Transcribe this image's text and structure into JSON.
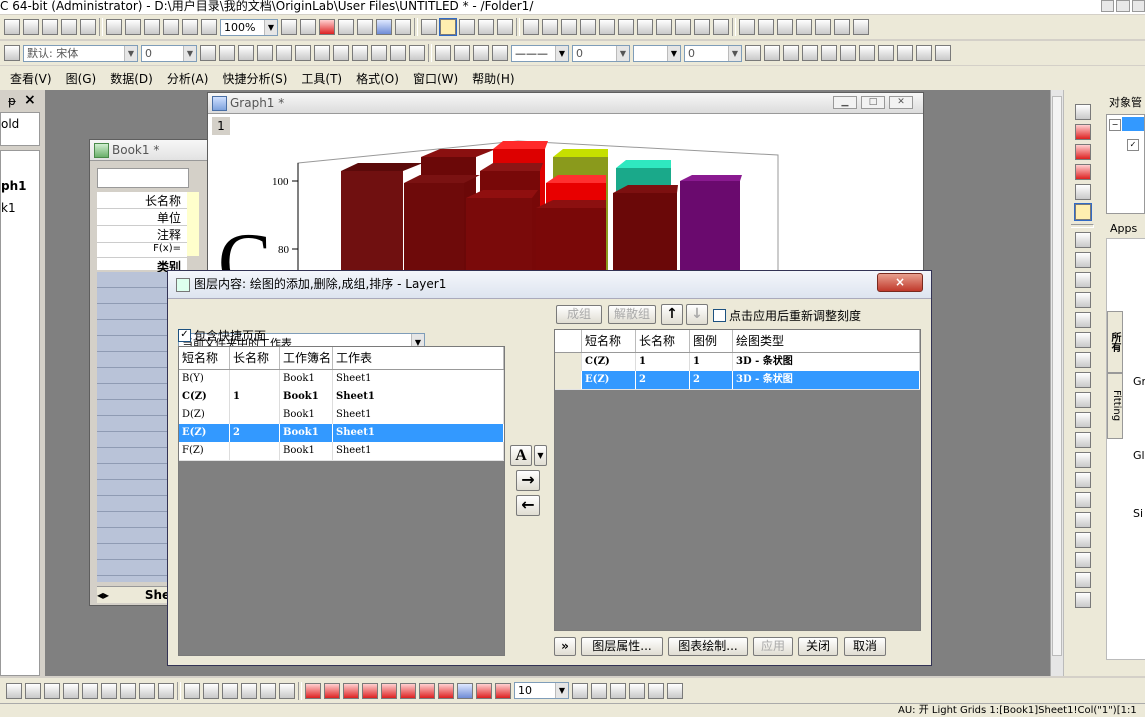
{
  "app": {
    "title": "C 64-bit (Administrator) - D:\\用户目录\\我的文档\\OriginLab\\User Files\\UNTITLED * - /Folder1/"
  },
  "toolbar": {
    "zoom": "100%",
    "font_name": "默认: 宋体",
    "font_size": "0",
    "line_width": "0",
    "line_width2": "0",
    "bottom_size": "10"
  },
  "menu": [
    "查看(V)",
    "图(G)",
    "数据(D)",
    "分析(A)",
    "快捷分析(S)",
    "工具(T)",
    "格式(O)",
    "窗口(W)",
    "帮助(H)"
  ],
  "left_panel": {
    "close_glyph": "×",
    "pin_glyph": "ᵽ",
    "items": [
      "old",
      "ph1",
      "k1"
    ]
  },
  "right_panel": {
    "object_manager": "对象管",
    "apps": "Apps",
    "tab_all": "所有",
    "tab_fitting": "Fitting",
    "labels": [
      "Gr",
      "Gl",
      "Si"
    ]
  },
  "book1": {
    "title": "Book1 *",
    "row_labels": [
      "长名称",
      "单位",
      "注释",
      "F(x)=",
      "类别"
    ],
    "sheet_tab": "She"
  },
  "graph1": {
    "title": "Graph1 *",
    "layer_num": "1",
    "ytick_100": "100",
    "ytick_80": "80",
    "big_letter": "C"
  },
  "dialog": {
    "title": "图层内容: 绘图的添加,删除,成组,排序 - Layer1",
    "close": "×",
    "source_select": "当前文件夹中的工作表",
    "include_shortcut": "包含快捷页面",
    "left_headers": [
      "短名称",
      "长名称",
      "工作簿名",
      "工作表"
    ],
    "left_rows": [
      {
        "short": "B(Y)",
        "long": "",
        "book": "Book1",
        "sheet": "Sheet1"
      },
      {
        "short": "C(Z)",
        "long": "1",
        "book": "Book1",
        "sheet": "Sheet1"
      },
      {
        "short": "D(Z)",
        "long": "",
        "book": "Book1",
        "sheet": "Sheet1"
      },
      {
        "short": "E(Z)",
        "long": "2",
        "book": "Book1",
        "sheet": "Sheet1"
      },
      {
        "short": "F(Z)",
        "long": "",
        "book": "Book1",
        "sheet": "Sheet1"
      }
    ],
    "group_btn": "成组",
    "ungroup_btn": "解散组",
    "rescale_label": "点击应用后重新调整刻度",
    "right_headers": [
      "短名称",
      "长名称",
      "图例",
      "绘图类型"
    ],
    "right_rows": [
      {
        "short": "C(Z)",
        "long": "1",
        "legend": "1",
        "type": "3D - 条状图"
      },
      {
        "short": "E(Z)",
        "long": "2",
        "legend": "2",
        "type": "3D - 条状图"
      }
    ],
    "mid_a": "A",
    "expand_btn": "»",
    "layer_props_btn": "图层属性...",
    "plot_setup_btn": "图表绘制...",
    "apply_btn": "应用",
    "close_btn": "关闭",
    "cancel_btn": "取消"
  },
  "status": {
    "text": "AU: 开  Light Grids  1:[Book1]Sheet1!Col(\"1\")[1:1"
  }
}
